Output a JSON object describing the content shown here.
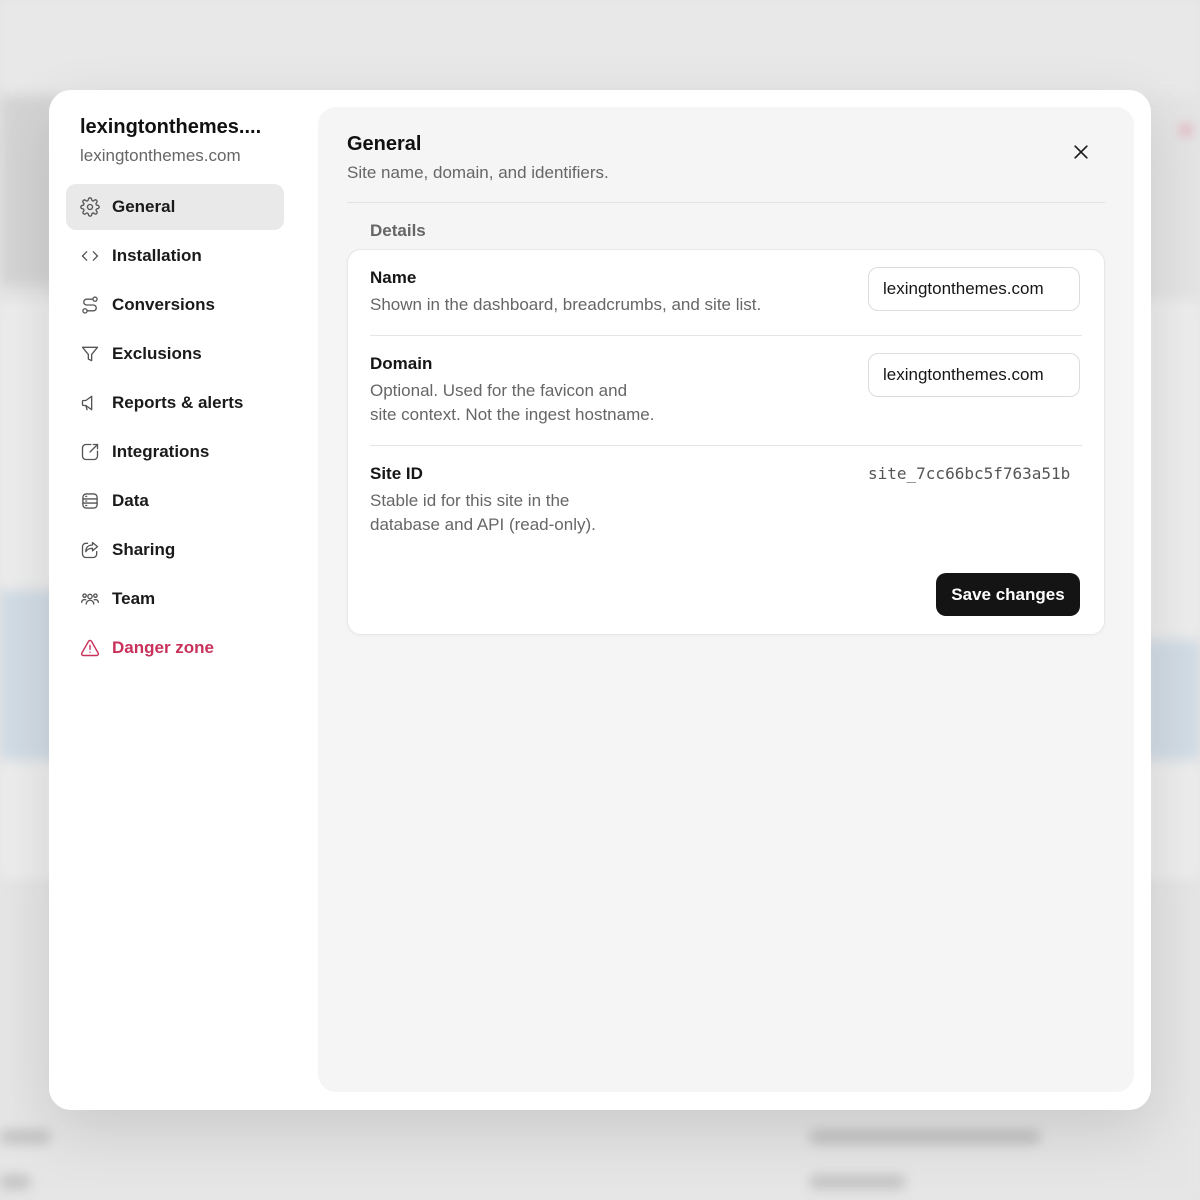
{
  "site": {
    "title": "lexingtonthemes....",
    "domain": "lexingtonthemes.com"
  },
  "nav": {
    "items": [
      {
        "label": "General",
        "icon": "gear-icon",
        "active": true
      },
      {
        "label": "Installation",
        "icon": "code-icon"
      },
      {
        "label": "Conversions",
        "icon": "route-icon"
      },
      {
        "label": "Exclusions",
        "icon": "filter-icon"
      },
      {
        "label": "Reports & alerts",
        "icon": "megaphone-icon"
      },
      {
        "label": "Integrations",
        "icon": "external-link-icon"
      },
      {
        "label": "Data",
        "icon": "database-icon"
      },
      {
        "label": "Sharing",
        "icon": "share-icon"
      },
      {
        "label": "Team",
        "icon": "users-icon"
      },
      {
        "label": "Danger zone",
        "icon": "warning-icon",
        "danger": true
      }
    ]
  },
  "content": {
    "title": "General",
    "subtitle": "Site name, domain, and identifiers.",
    "section_label": "Details",
    "name": {
      "label": "Name",
      "description": "Shown in the dashboard, breadcrumbs, and site list.",
      "value": "lexingtonthemes.com"
    },
    "domain": {
      "label": "Domain",
      "description_line1": "Optional. Used for the favicon and",
      "description_line2": "site context. Not the ingest hostname.",
      "value": "lexingtonthemes.com"
    },
    "site_id": {
      "label": "Site ID",
      "description_line1": "Stable id for this site in the",
      "description_line2": "database and API (read-only).",
      "value": "site_7cc66bc5f763a51b"
    },
    "save_label": "Save changes"
  },
  "colors": {
    "danger": "#c8325a",
    "primary_button": "#141414"
  }
}
